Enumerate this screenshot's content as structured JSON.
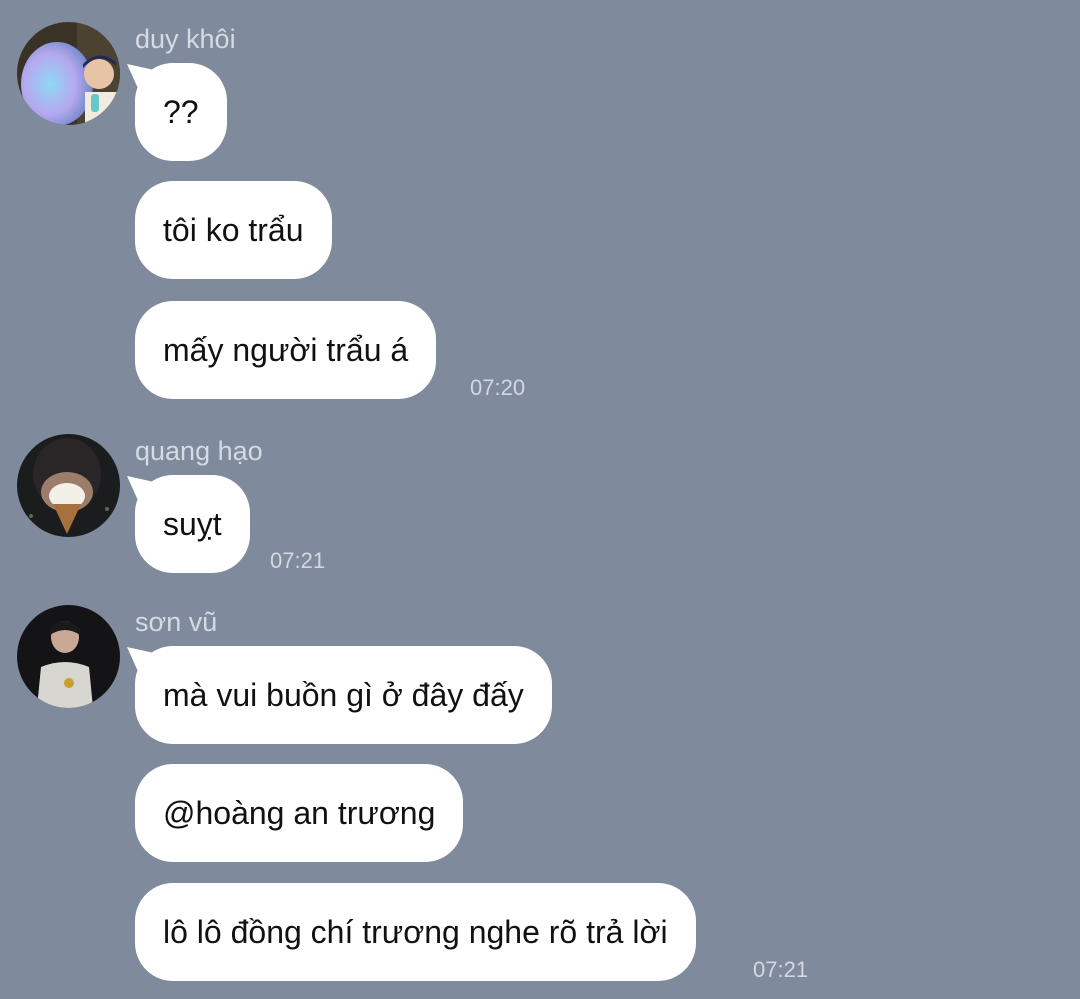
{
  "chat": {
    "groups": [
      {
        "sender": "duy khôi",
        "avatar": "profile-photo-duy-khoi",
        "messages": [
          "??",
          "tôi ko trẩu",
          "mấy người trẩu á"
        ],
        "time": "07:20"
      },
      {
        "sender": "quang hạo",
        "avatar": "profile-photo-quang-hao",
        "messages": [
          "suỵt"
        ],
        "time": "07:21"
      },
      {
        "sender": "sơn vũ",
        "avatar": "profile-photo-son-vu",
        "messages": [
          "mà vui buồn gì ở đây đấy",
          "@hoàng an trương",
          "lô lô đồng chí trương nghe rõ trả lời"
        ],
        "time": "07:21"
      }
    ]
  },
  "colors": {
    "background": "#7f8a9c",
    "bubble": "#ffffff",
    "sender_name": "#d5dae3",
    "timestamp": "#d3d8e1"
  }
}
